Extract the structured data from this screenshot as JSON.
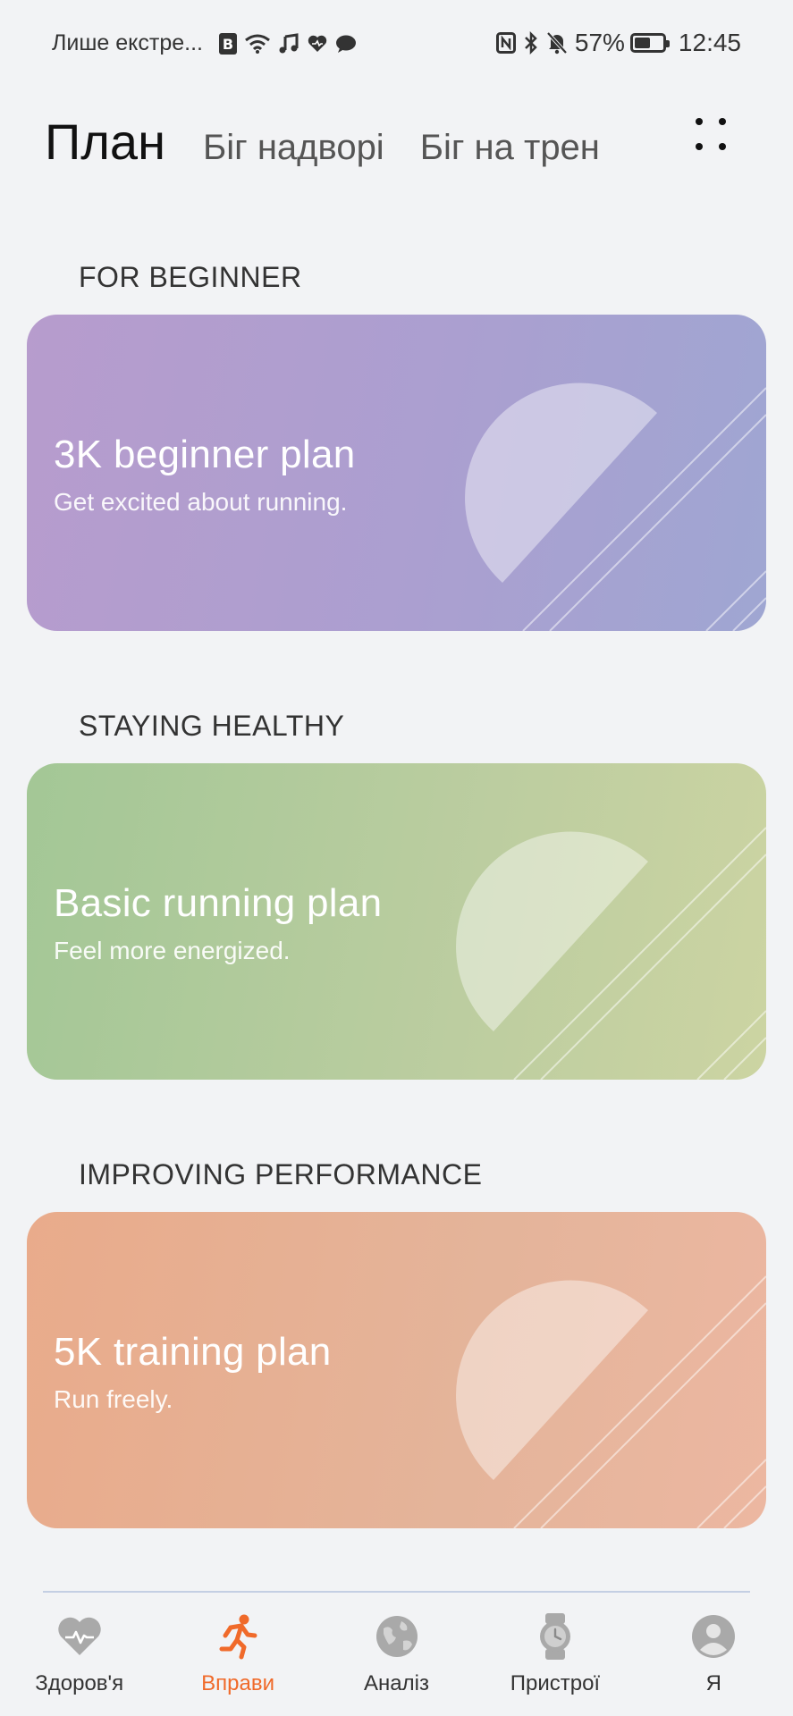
{
  "status_bar": {
    "notification_text": "Лише екстре...",
    "battery_percent": "57%",
    "battery_level": 0.57,
    "time": "12:45",
    "left_icons": [
      "b-badge-icon",
      "wifi-icon",
      "music-note-icon",
      "heart-icon",
      "chat-bubble-icon"
    ],
    "right_icons": [
      "nfc-icon",
      "bluetooth-icon",
      "bell-muted-icon",
      "battery-icon"
    ]
  },
  "tabs": [
    {
      "label": "План",
      "active": true
    },
    {
      "label": "Біг надворі",
      "active": false
    },
    {
      "label": "Біг на трен",
      "active": false
    }
  ],
  "more_icon": "more-dots-icon",
  "sections": [
    {
      "title": "FOR BEGINNER",
      "card": {
        "title": "3K beginner plan",
        "subtitle": "Get excited about running.",
        "color": "#b0a0d0"
      }
    },
    {
      "title": "STAYING HEALTHY",
      "card": {
        "title": "Basic running plan",
        "subtitle": "Feel more energized.",
        "color": "#b8cc9c"
      }
    },
    {
      "title": "IMPROVING PERFORMANCE",
      "card": {
        "title": "5K training plan",
        "subtitle": "Run freely.",
        "color": "#e6b196"
      }
    }
  ],
  "bottom_nav": [
    {
      "label": "Здоров'я",
      "icon": "heart-pulse-icon",
      "active": false
    },
    {
      "label": "Вправи",
      "icon": "running-person-icon",
      "active": true
    },
    {
      "label": "Аналіз",
      "icon": "globe-icon",
      "active": false
    },
    {
      "label": "Пристрої",
      "icon": "watch-icon",
      "active": false
    },
    {
      "label": "Я",
      "icon": "user-avatar-icon",
      "active": false
    }
  ],
  "colors": {
    "accent": "#f06a2a",
    "background": "#f2f3f5",
    "inactive_icon": "#a9a9a9"
  }
}
